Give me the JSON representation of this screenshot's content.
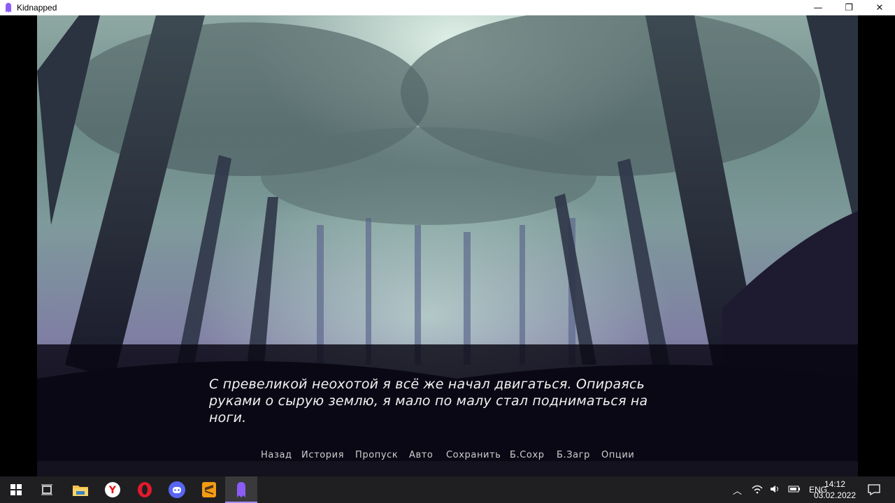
{
  "window": {
    "title": "Kidnapped",
    "controls": {
      "minimize": "—",
      "maximize": "❐",
      "close": "✕"
    }
  },
  "scene": {
    "background": "forest"
  },
  "dialogue": {
    "line1": "С превеликой неохотой я всё же начал двигаться. Опираясь",
    "line2": "руками о сырую землю, я мало по малу стал подниматься на",
    "line3": "ноги."
  },
  "quick_menu": {
    "back": "Назад",
    "history": "История",
    "skip": "Пропуск",
    "auto": "Авто",
    "save": "Сохранить",
    "quick_save": "Б.Сохр",
    "quick_load": "Б.Загр",
    "options": "Опции"
  },
  "taskbar": {
    "apps": [
      "start-icon",
      "task-view-icon",
      "file-explorer-icon",
      "yandex-browser-icon",
      "opera-icon",
      "discord-icon",
      "sublime-text-icon",
      "renpy-game-icon"
    ],
    "tray": {
      "language": "ENG",
      "time": "14:12",
      "date": "03.02.2022"
    }
  },
  "colors": {
    "accent": "#a78bfa",
    "taskbar": "#1f1f22",
    "dialogue_text": "#f2f2f2",
    "menu_text": "#cfcfcf"
  }
}
